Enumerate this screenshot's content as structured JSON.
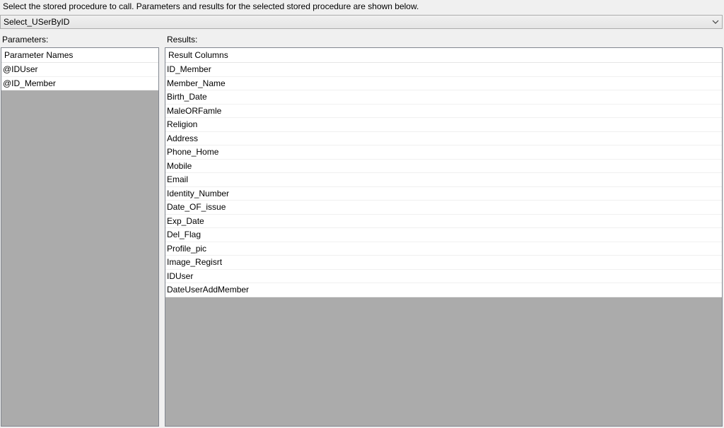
{
  "instruction": "Select the stored procedure to call. Parameters and results for the selected stored procedure are shown below.",
  "procedure_select": {
    "value": "Select_USerByID",
    "icon": "chevron-down-icon"
  },
  "parameters": {
    "label": "Parameters:",
    "column_header": "Parameter Names",
    "rows": [
      "@IDUser",
      "@ID_Member"
    ]
  },
  "results": {
    "label": "Results:",
    "column_header": "Result Columns",
    "rows": [
      "ID_Member",
      "Member_Name",
      "Birth_Date",
      "MaleORFamle",
      "Religion",
      "Address",
      "Phone_Home",
      "Mobile",
      "Email",
      "Identity_Number",
      "Date_OF_issue",
      "Exp_Date",
      "Del_Flag",
      "Profile_pic",
      "Image_Regisrt",
      "IDUser",
      "DateUserAddMember"
    ]
  },
  "colors": {
    "empty_area": "#ababab",
    "window_bg": "#f0f0f0",
    "row_bg": "#ffffff"
  }
}
